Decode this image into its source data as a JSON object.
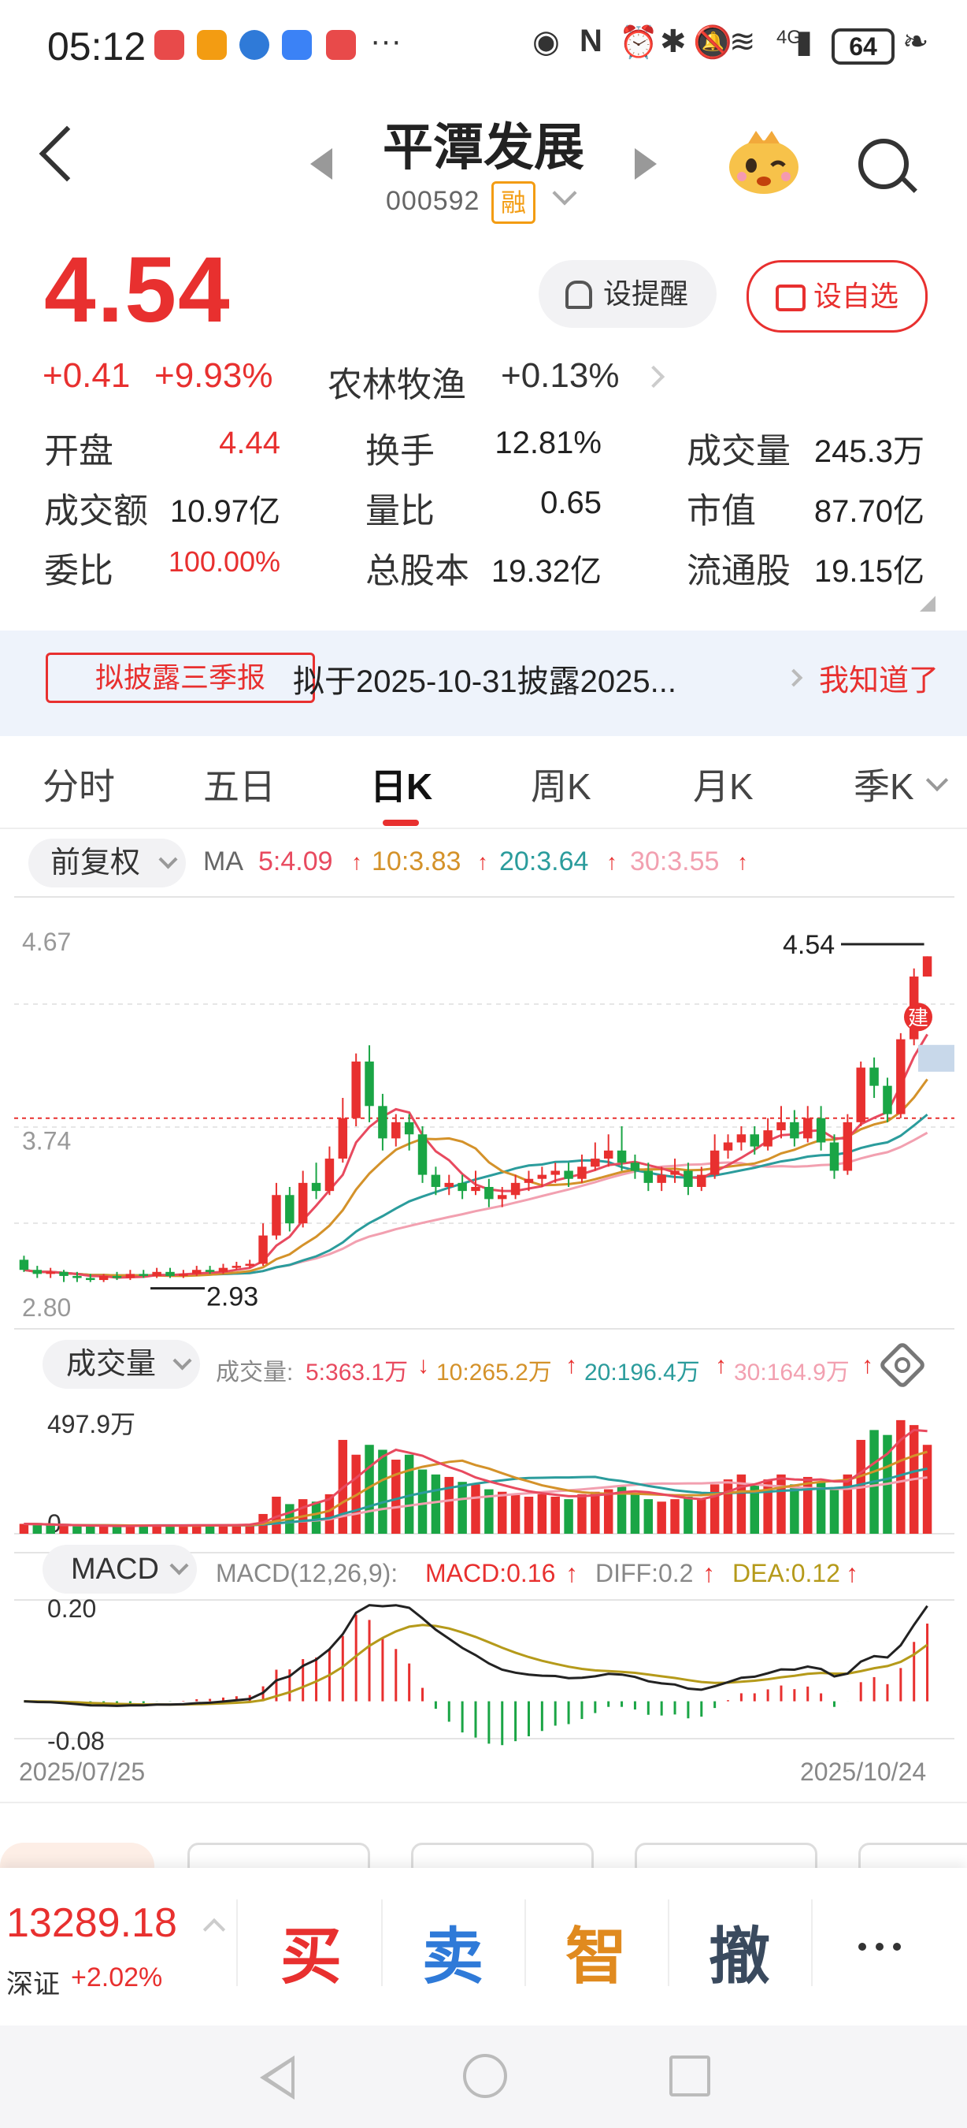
{
  "status_bar": {
    "time": "05:12",
    "signal": "4G",
    "battery": "64"
  },
  "header": {
    "stock_name": "平潭发展",
    "stock_code": "000592",
    "margin_tag": "融"
  },
  "quote": {
    "price": "4.54",
    "change": "+0.41",
    "change_pct": "+9.93%",
    "sector_name": "农林牧渔",
    "sector_change": "+0.13%",
    "alert_button": "设提醒",
    "favorite_button": "设自选",
    "stats": [
      {
        "label": "开盘",
        "value": "4.44",
        "color": "#e8302f"
      },
      {
        "label": "换手",
        "value": "12.81%",
        "color": "#222222"
      },
      {
        "label": "成交量",
        "value": "245.3万",
        "color": "#222222"
      },
      {
        "label": "成交额",
        "value": "10.97亿",
        "color": "#222222"
      },
      {
        "label": "量比",
        "value": "0.65",
        "color": "#222222"
      },
      {
        "label": "市值",
        "value": "87.70亿",
        "color": "#222222"
      },
      {
        "label": "委比",
        "value": "100.00%",
        "color": "#e8302f"
      },
      {
        "label": "总股本",
        "value": "19.32亿",
        "color": "#222222"
      },
      {
        "label": "流通股",
        "value": "19.15亿",
        "color": "#222222"
      }
    ]
  },
  "notice": {
    "tag": "拟披露三季报",
    "text": "拟于2025-10-31披露2025...",
    "action": "我知道了"
  },
  "tabs": [
    "分时",
    "五日",
    "日K",
    "周K",
    "月K",
    "季K"
  ],
  "active_tab": "日K",
  "ma_bar": {
    "adjust": "前复权",
    "label": "MA",
    "items": [
      {
        "text": "5:4.09",
        "color": "#e84a5f"
      },
      {
        "text": "10:3.83",
        "color": "#d4922a"
      },
      {
        "text": "20:3.64",
        "color": "#2b9c9c"
      },
      {
        "text": "30:3.55",
        "color": "#f2a0b0"
      }
    ]
  },
  "vol_bar": {
    "name": "成交量",
    "label": "成交量:",
    "items": [
      {
        "text": "5:363.1万",
        "color": "#e84a5f",
        "dir": "down"
      },
      {
        "text": "10:265.2万",
        "color": "#d4922a",
        "dir": "up"
      },
      {
        "text": "20:196.4万",
        "color": "#2b9c9c",
        "dir": "up"
      },
      {
        "text": "30:164.9万",
        "color": "#f2a0b0",
        "dir": "up"
      }
    ]
  },
  "macd_bar": {
    "name": "MACD",
    "params": "MACD(12,26,9):",
    "items": [
      {
        "text": "MACD:0.16",
        "color": "#e8302f"
      },
      {
        "text": "DIFF:0.2",
        "color": "#888888"
      },
      {
        "text": "DEA:0.12",
        "color": "#b59a1a"
      }
    ]
  },
  "chart_data": [
    {
      "type": "candlestick",
      "y_axis_labels": [
        "4.67",
        "3.74",
        "2.80"
      ],
      "ylim": [
        2.8,
        4.67
      ],
      "high_label": "4.54",
      "low_label": "2.93",
      "marker": "建",
      "dashed_line": 3.74,
      "colors": {
        "up": "#e8302f",
        "down": "#1aa545",
        "ma5": "#e84a5f",
        "ma10": "#d4922a",
        "ma20": "#2b9c9c",
        "ma30": "#f2a0b0"
      },
      "candles": [
        [
          3.04,
          2.99,
          3.06,
          2.98
        ],
        [
          2.99,
          2.97,
          3.01,
          2.95
        ],
        [
          2.97,
          2.98,
          3.0,
          2.95
        ],
        [
          2.98,
          2.96,
          2.99,
          2.93
        ],
        [
          2.96,
          2.95,
          2.98,
          2.93
        ],
        [
          2.95,
          2.94,
          2.97,
          2.93
        ],
        [
          2.94,
          2.96,
          2.97,
          2.93
        ],
        [
          2.96,
          2.95,
          2.98,
          2.94
        ],
        [
          2.95,
          2.97,
          2.99,
          2.94
        ],
        [
          2.97,
          2.96,
          2.99,
          2.95
        ],
        [
          2.96,
          2.98,
          3.0,
          2.95
        ],
        [
          2.98,
          2.96,
          3.0,
          2.95
        ],
        [
          2.96,
          2.97,
          2.99,
          2.95
        ],
        [
          2.97,
          2.99,
          3.01,
          2.96
        ],
        [
          2.99,
          2.98,
          3.01,
          2.97
        ],
        [
          2.98,
          3.0,
          3.02,
          2.97
        ],
        [
          3.0,
          3.01,
          3.03,
          2.99
        ],
        [
          3.01,
          3.02,
          3.04,
          3.0
        ],
        [
          3.02,
          3.16,
          3.22,
          3.01
        ],
        [
          3.16,
          3.36,
          3.42,
          3.14
        ],
        [
          3.36,
          3.22,
          3.4,
          3.18
        ],
        [
          3.22,
          3.42,
          3.48,
          3.2
        ],
        [
          3.42,
          3.38,
          3.52,
          3.34
        ],
        [
          3.38,
          3.54,
          3.6,
          3.36
        ],
        [
          3.54,
          3.74,
          3.84,
          3.52
        ],
        [
          3.74,
          4.02,
          4.06,
          3.7
        ],
        [
          4.02,
          3.8,
          4.1,
          3.72
        ],
        [
          3.8,
          3.64,
          3.86,
          3.58
        ],
        [
          3.64,
          3.72,
          3.76,
          3.6
        ],
        [
          3.72,
          3.66,
          3.76,
          3.58
        ],
        [
          3.66,
          3.46,
          3.7,
          3.42
        ],
        [
          3.46,
          3.4,
          3.5,
          3.36
        ],
        [
          3.4,
          3.42,
          3.46,
          3.36
        ],
        [
          3.42,
          3.38,
          3.46,
          3.34
        ],
        [
          3.38,
          3.4,
          3.48,
          3.36
        ],
        [
          3.4,
          3.34,
          3.44,
          3.3
        ],
        [
          3.34,
          3.36,
          3.4,
          3.3
        ],
        [
          3.36,
          3.42,
          3.46,
          3.34
        ],
        [
          3.42,
          3.44,
          3.48,
          3.38
        ],
        [
          3.44,
          3.46,
          3.5,
          3.4
        ],
        [
          3.46,
          3.48,
          3.52,
          3.42
        ],
        [
          3.48,
          3.44,
          3.52,
          3.4
        ],
        [
          3.44,
          3.5,
          3.56,
          3.42
        ],
        [
          3.5,
          3.54,
          3.62,
          3.48
        ],
        [
          3.54,
          3.58,
          3.66,
          3.5
        ],
        [
          3.58,
          3.52,
          3.7,
          3.48
        ],
        [
          3.52,
          3.48,
          3.56,
          3.44
        ],
        [
          3.48,
          3.42,
          3.52,
          3.38
        ],
        [
          3.42,
          3.46,
          3.5,
          3.38
        ],
        [
          3.46,
          3.48,
          3.54,
          3.42
        ],
        [
          3.48,
          3.4,
          3.52,
          3.36
        ],
        [
          3.4,
          3.46,
          3.5,
          3.38
        ],
        [
          3.46,
          3.58,
          3.66,
          3.44
        ],
        [
          3.58,
          3.62,
          3.66,
          3.54
        ],
        [
          3.62,
          3.66,
          3.7,
          3.58
        ],
        [
          3.66,
          3.6,
          3.7,
          3.56
        ],
        [
          3.6,
          3.68,
          3.74,
          3.58
        ],
        [
          3.68,
          3.72,
          3.8,
          3.64
        ],
        [
          3.72,
          3.64,
          3.78,
          3.6
        ],
        [
          3.64,
          3.74,
          3.8,
          3.62
        ],
        [
          3.74,
          3.62,
          3.8,
          3.58
        ],
        [
          3.62,
          3.48,
          3.66,
          3.44
        ],
        [
          3.48,
          3.72,
          3.76,
          3.46
        ],
        [
          3.72,
          3.99,
          4.02,
          3.7
        ],
        [
          3.99,
          3.9,
          4.04,
          3.84
        ],
        [
          3.9,
          3.76,
          3.94,
          3.72
        ],
        [
          3.76,
          4.13,
          4.16,
          3.74
        ],
        [
          4.13,
          4.44,
          4.48,
          4.1
        ],
        [
          4.44,
          4.54,
          4.54,
          4.44
        ]
      ]
    },
    {
      "type": "bar",
      "name": "成交量",
      "y_axis_labels": [
        "497.9万",
        "0"
      ],
      "ylim": [
        0,
        497.9
      ],
      "values": [
        40,
        38,
        34,
        32,
        30,
        32,
        34,
        30,
        32,
        34,
        36,
        34,
        32,
        36,
        34,
        36,
        38,
        40,
        80,
        150,
        120,
        140,
        130,
        160,
        380,
        320,
        360,
        340,
        300,
        320,
        260,
        240,
        230,
        210,
        200,
        180,
        170,
        160,
        150,
        160,
        150,
        140,
        160,
        170,
        180,
        190,
        160,
        140,
        130,
        140,
        150,
        140,
        200,
        220,
        240,
        200,
        220,
        240,
        200,
        230,
        210,
        180,
        240,
        380,
        420,
        400,
        460,
        440,
        360
      ],
      "up_flags": [
        1,
        0,
        0,
        1,
        0,
        0,
        1,
        0,
        1,
        0,
        1,
        0,
        1,
        1,
        0,
        1,
        1,
        1,
        1,
        1,
        0,
        1,
        0,
        1,
        1,
        1,
        0,
        0,
        1,
        0,
        0,
        0,
        1,
        0,
        1,
        0,
        1,
        1,
        1,
        1,
        1,
        0,
        1,
        1,
        1,
        0,
        0,
        0,
        1,
        1,
        0,
        1,
        1,
        1,
        1,
        0,
        1,
        1,
        0,
        1,
        0,
        0,
        1,
        1,
        0,
        0,
        1,
        1,
        1
      ]
    },
    {
      "type": "macd",
      "y_axis_labels": [
        "0.20",
        "-0.08"
      ],
      "ylim": [
        -0.08,
        0.2
      ],
      "x_labels": [
        "2025/07/25",
        "2025/10/24"
      ]
    }
  ],
  "bottom_bar": {
    "index_value": "13289.18",
    "index_name": "深证",
    "index_change": "+2.02%",
    "actions": [
      {
        "label": "买",
        "color": "#e8302f"
      },
      {
        "label": "卖",
        "color": "#2f7ad8"
      },
      {
        "label": "智",
        "color": "#e08a1f"
      },
      {
        "label": "撤",
        "color": "#3a4a5e"
      }
    ]
  }
}
